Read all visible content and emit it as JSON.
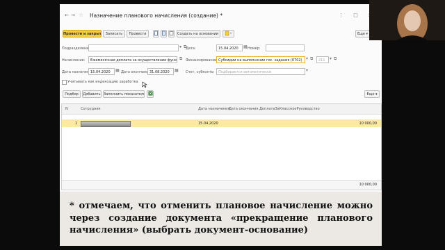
{
  "window": {
    "title": "Назначение планового начисления (создание) *",
    "nav_back": "←",
    "nav_fwd": "→",
    "star": "☆",
    "controls": "⋮ □ ×"
  },
  "toolbar": {
    "post_close": "Провести и закрыть",
    "save": "Записать",
    "post": "Провести",
    "create_basis": "Создать на основании ▾",
    "more": "Еще ▾",
    "help": "?"
  },
  "form": {
    "division_label": "Подразделение:",
    "division_value": "",
    "date_label": "Дата:",
    "date_value": "15.04.2020",
    "number_label": "Номер:",
    "number_value": "",
    "accrual_label": "Начисление:",
    "accrual_value": "Ежемесячная доплата за осуществление функций классного руков",
    "financing_label": "Финансирование:",
    "financing_value": "Субсидии на выполнение гос. задания (0702)",
    "kosgu_value": "211",
    "start_label": "Дата назначения:",
    "start_value": "15.04.2020",
    "end_label": "Дата окончания:",
    "end_value": "31.08.2020",
    "account_label": "Счет, субконто:",
    "account_placeholder": "Подбирается автоматически",
    "indexation_label": "Учитывать как индексацию заработка"
  },
  "table_toolbar": {
    "select": "Подбор",
    "add": "Добавить",
    "fill": "Заполнить показатели",
    "more": "Еще ▾"
  },
  "table": {
    "columns": [
      "N",
      "Сотрудник",
      "Дата назначения",
      "Дата окончания",
      "ДоплатаЗаКлассноеРуководство"
    ],
    "rows": [
      {
        "n": "1",
        "employee": "",
        "start": "15.04.2020",
        "end": "",
        "amount": "10 000,00"
      }
    ],
    "total": "10 000,00"
  },
  "caption": "* отмечаем, что отменить плановое начисление можно через создание документа «прекращение планового начисления» (выбрать документ-основание)",
  "colors": {
    "accent": "#f6cf3d",
    "row_highlight": "#fbe9a5",
    "background": "#0b0b0b"
  }
}
